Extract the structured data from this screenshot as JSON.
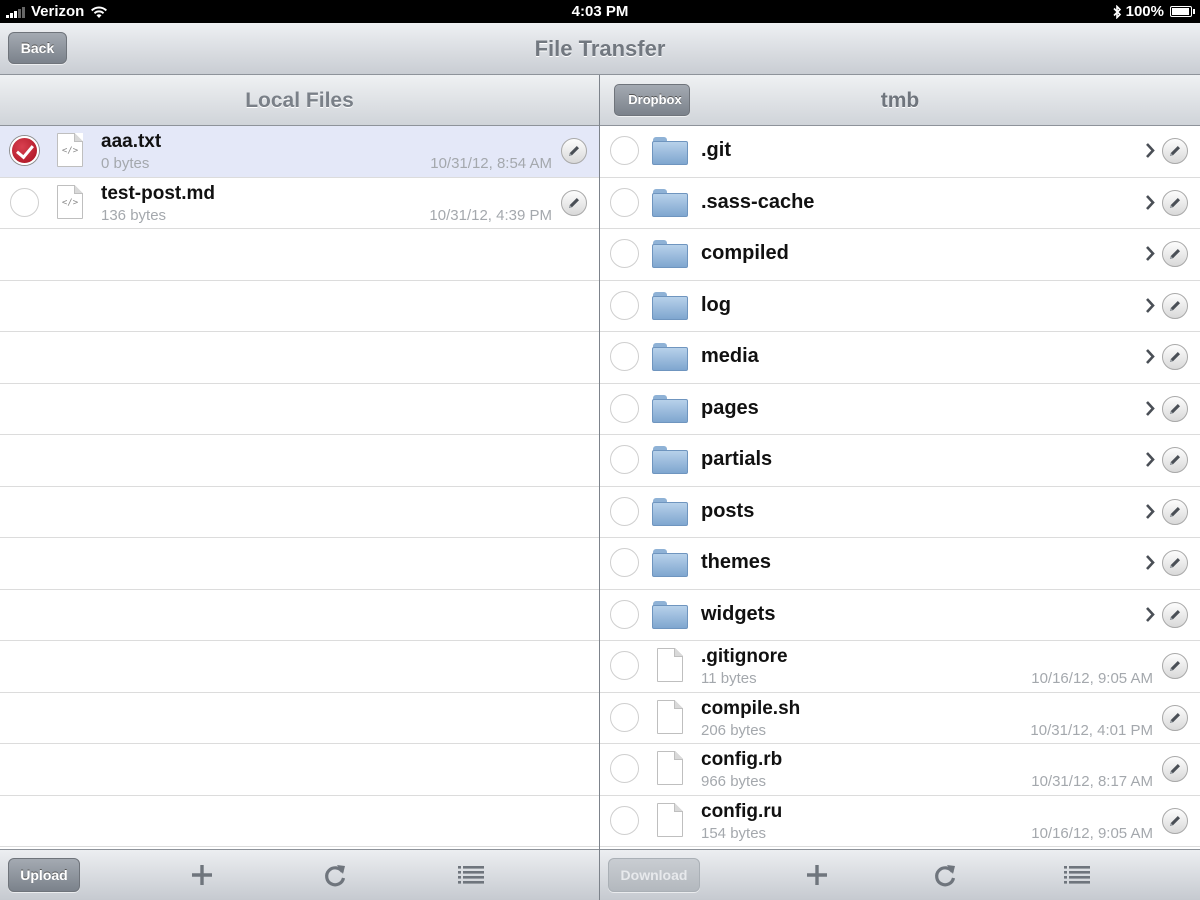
{
  "status": {
    "carrier": "Verizon",
    "time": "4:03 PM",
    "battery": "100%",
    "battery_level": 1.0
  },
  "nav": {
    "back_label": "Back",
    "title": "File Transfer"
  },
  "local": {
    "title": "Local Files",
    "files": [
      {
        "name": "aaa.txt",
        "size": "0 bytes",
        "date": "10/31/12, 8:54 AM",
        "selected": true
      },
      {
        "name": "test-post.md",
        "size": "136 bytes",
        "date": "10/31/12, 4:39 PM",
        "selected": false
      }
    ],
    "toolbar": {
      "upload_label": "Upload"
    }
  },
  "remote": {
    "back_label": "Dropbox",
    "title": "tmb",
    "folders": [
      ".git",
      ".sass-cache",
      "compiled",
      "log",
      "media",
      "pages",
      "partials",
      "posts",
      "themes",
      "widgets"
    ],
    "files": [
      {
        "name": ".gitignore",
        "size": "11 bytes",
        "date": "10/16/12, 9:05 AM"
      },
      {
        "name": "compile.sh",
        "size": "206 bytes",
        "date": "10/31/12, 4:01 PM"
      },
      {
        "name": "config.rb",
        "size": "966 bytes",
        "date": "10/31/12, 8:17 AM"
      },
      {
        "name": "config.ru",
        "size": "154 bytes",
        "date": "10/16/12, 9:05 AM"
      }
    ],
    "toolbar": {
      "download_label": "Download"
    }
  }
}
